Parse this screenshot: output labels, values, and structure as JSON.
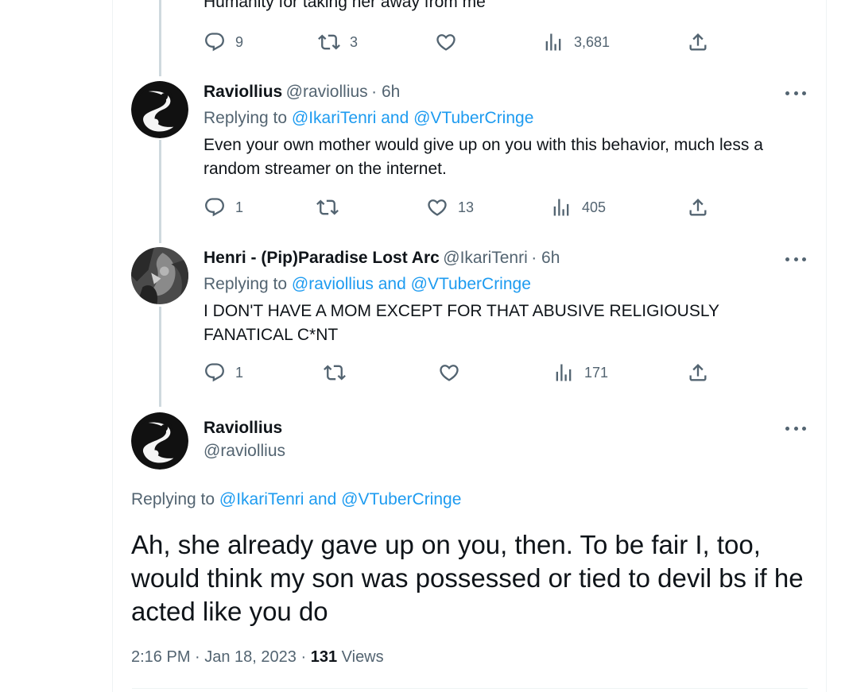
{
  "top_tweet": {
    "text_tail": "Humanity for taking her away from me",
    "actions": {
      "replies": "9",
      "retweets": "3",
      "likes": "",
      "views": "3,681"
    }
  },
  "tweet1": {
    "name": "Raviollius",
    "handle": "@raviollius",
    "time": "· 6h",
    "replying_label": "Replying to",
    "replying_targets": "@IkariTenri and @VTuberCringe",
    "text": "Even your own mother would give up on you with this behavior, much less a random streamer on the internet.",
    "actions": {
      "replies": "1",
      "retweets": "",
      "likes": "13",
      "views": "405"
    }
  },
  "tweet2": {
    "name": "Henri - (Pip)Paradise Lost Arc",
    "handle": "@IkariTenri",
    "time": "· 6h",
    "replying_label": "Replying to",
    "replying_targets": "@raviollius and @VTuberCringe",
    "text": "I DON'T HAVE A MOM EXCEPT FOR THAT ABUSIVE RELIGIOUSLY FANATICAL C*NT",
    "actions": {
      "replies": "1",
      "retweets": "",
      "likes": "",
      "views": "171"
    }
  },
  "main_tweet": {
    "name": "Raviollius",
    "handle": "@raviollius",
    "replying_label": "Replying to",
    "replying_targets": "@IkariTenri and @VTuberCringe",
    "text": "Ah, she already gave up on you, then. To be fair I, too, would think my son was possessed or tied to devil bs if he acted like you do",
    "timestamp": "2:16 PM · Jan 18, 2023 ·",
    "views_count": "131",
    "views_label": "Views"
  },
  "icons": {
    "reply": "reply-icon",
    "retweet": "retweet-icon",
    "like": "heart-icon",
    "views": "views-icon",
    "share": "share-icon",
    "more": "more-icon"
  },
  "colors": {
    "link": "#1d9bf0",
    "secondary_text": "#536471",
    "primary_text": "#0f1419",
    "thread_line": "#cfd9de"
  }
}
